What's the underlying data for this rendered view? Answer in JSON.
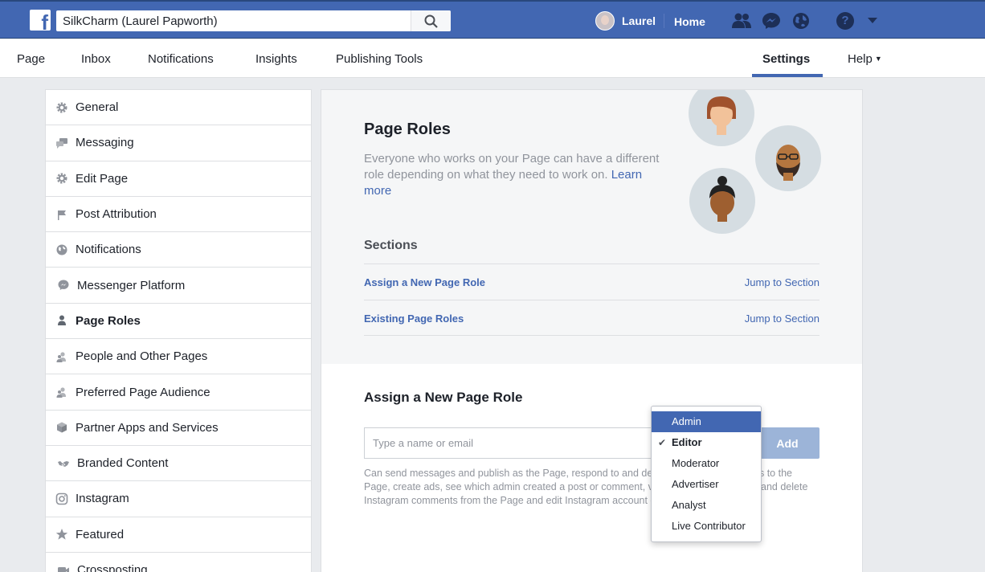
{
  "topbar": {
    "logo_letter": "f",
    "search_value": "SilkCharm (Laurel Papworth)",
    "user_name": "Laurel",
    "home_label": "Home",
    "icons": [
      "friends-icon",
      "messenger-icon",
      "globe-icon",
      "help-icon",
      "account-caret-icon"
    ]
  },
  "subnav": {
    "tabs": [
      "Page",
      "Inbox",
      "Notifications",
      "Insights",
      "Publishing Tools"
    ],
    "settings_label": "Settings",
    "help_label": "Help"
  },
  "sidebar": {
    "items": [
      {
        "label": "General",
        "icon": "gear-icon"
      },
      {
        "label": "Messaging",
        "icon": "chat-bubbles-icon"
      },
      {
        "label": "Edit Page",
        "icon": "gear-icon"
      },
      {
        "label": "Post Attribution",
        "icon": "flag-icon"
      },
      {
        "label": "Notifications",
        "icon": "globe-icon"
      },
      {
        "label": "Messenger Platform",
        "icon": "messenger-icon"
      },
      {
        "label": "Page Roles",
        "icon": "person-icon"
      },
      {
        "label": "People and Other Pages",
        "icon": "people-icon"
      },
      {
        "label": "Preferred Page Audience",
        "icon": "people-icon"
      },
      {
        "label": "Partner Apps and Services",
        "icon": "cube-icon"
      },
      {
        "label": "Branded Content",
        "icon": "handshake-icon"
      },
      {
        "label": "Instagram",
        "icon": "instagram-icon"
      },
      {
        "label": "Featured",
        "icon": "star-icon"
      },
      {
        "label": "Crossposting",
        "icon": "video-icon"
      }
    ],
    "active_index": 6
  },
  "main": {
    "title": "Page Roles",
    "description": "Everyone who works on your Page can have a different role depending on what they need to work on.",
    "learn_more": "Learn more",
    "sections_title": "Sections",
    "sections": [
      {
        "label": "Assign a New Page Role",
        "jump": "Jump to Section"
      },
      {
        "label": "Existing Page Roles",
        "jump": "Jump to Section"
      }
    ],
    "assign_title": "Assign a New Page Role",
    "input_placeholder": "Type a name or email",
    "add_button": "Add",
    "role_description": "Can send messages and publish as the Page, respond to and delete comments and posts to the Page, create ads, see which admin created a post or comment, view insights, respond to and delete Instagram comments from the Page and edit Instagram account details from the Page."
  },
  "dropdown": {
    "options": [
      "Admin",
      "Editor",
      "Moderator",
      "Advertiser",
      "Analyst",
      "Live Contributor"
    ],
    "hover_index": 0,
    "selected_index": 1,
    "check_mark": "✔"
  },
  "colors": {
    "brand_blue": "#4267b2",
    "link_blue": "#4267b2",
    "add_button_disabled": "#9cb4d8"
  }
}
